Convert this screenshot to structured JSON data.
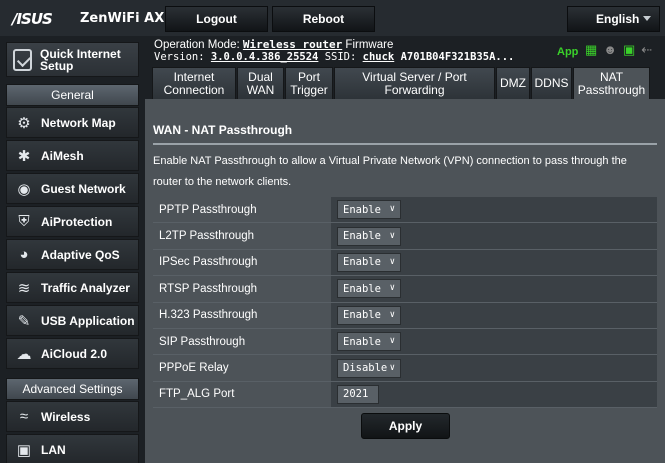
{
  "brand": {
    "logo": "/ISUS",
    "model": "ZenWiFi AX"
  },
  "topbar": {
    "logout": "Logout",
    "reboot": "Reboot",
    "language": "English"
  },
  "header": {
    "op_mode_label": "Operation Mode:",
    "op_mode_value": "Wireless router",
    "firmware_label": "Firmware",
    "version_label": "Version:",
    "version_value": "3.0.0.4.386_25524",
    "ssid_label": "SSID:",
    "ssid_value": "chuck",
    "ssid_extra": "A701B04F321B35A...",
    "app_label": "App"
  },
  "sidebar": {
    "quick_setup": "Quick Internet Setup",
    "general_head": "General",
    "general_items": [
      {
        "label": "Network Map",
        "icon": "network-map-icon"
      },
      {
        "label": "AiMesh",
        "icon": "aimesh-icon"
      },
      {
        "label": "Guest Network",
        "icon": "guest-network-icon"
      },
      {
        "label": "AiProtection",
        "icon": "aiprotection-icon"
      },
      {
        "label": "Adaptive QoS",
        "icon": "adaptive-qos-icon"
      },
      {
        "label": "Traffic Analyzer",
        "icon": "traffic-analyzer-icon"
      },
      {
        "label": "USB Application",
        "icon": "usb-application-icon"
      },
      {
        "label": "AiCloud 2.0",
        "icon": "aicloud-icon"
      }
    ],
    "advanced_head": "Advanced Settings",
    "advanced_items": [
      {
        "label": "Wireless",
        "icon": "wireless-icon"
      },
      {
        "label": "LAN",
        "icon": "lan-icon"
      }
    ]
  },
  "tabs": [
    {
      "label": "Internet Connection"
    },
    {
      "label": "Dual WAN"
    },
    {
      "label": "Port Trigger"
    },
    {
      "label": "Virtual Server / Port Forwarding"
    },
    {
      "label": "DMZ"
    },
    {
      "label": "DDNS"
    },
    {
      "label": "NAT Passthrough"
    }
  ],
  "main": {
    "title": "WAN - NAT Passthrough",
    "description": "Enable NAT Passthrough to allow a Virtual Private Network (VPN) connection to pass through the router to the network clients.",
    "rows": [
      {
        "label": "PPTP Passthrough",
        "value": "Enable"
      },
      {
        "label": "L2TP Passthrough",
        "value": "Enable"
      },
      {
        "label": "IPSec Passthrough",
        "value": "Enable"
      },
      {
        "label": "RTSP Passthrough",
        "value": "Enable"
      },
      {
        "label": "H.323 Passthrough",
        "value": "Enable"
      },
      {
        "label": "SIP Passthrough",
        "value": "Enable"
      },
      {
        "label": "PPPoE Relay",
        "value": "Disable"
      },
      {
        "label": "FTP_ALG Port",
        "value": "2021"
      }
    ],
    "apply": "Apply"
  }
}
